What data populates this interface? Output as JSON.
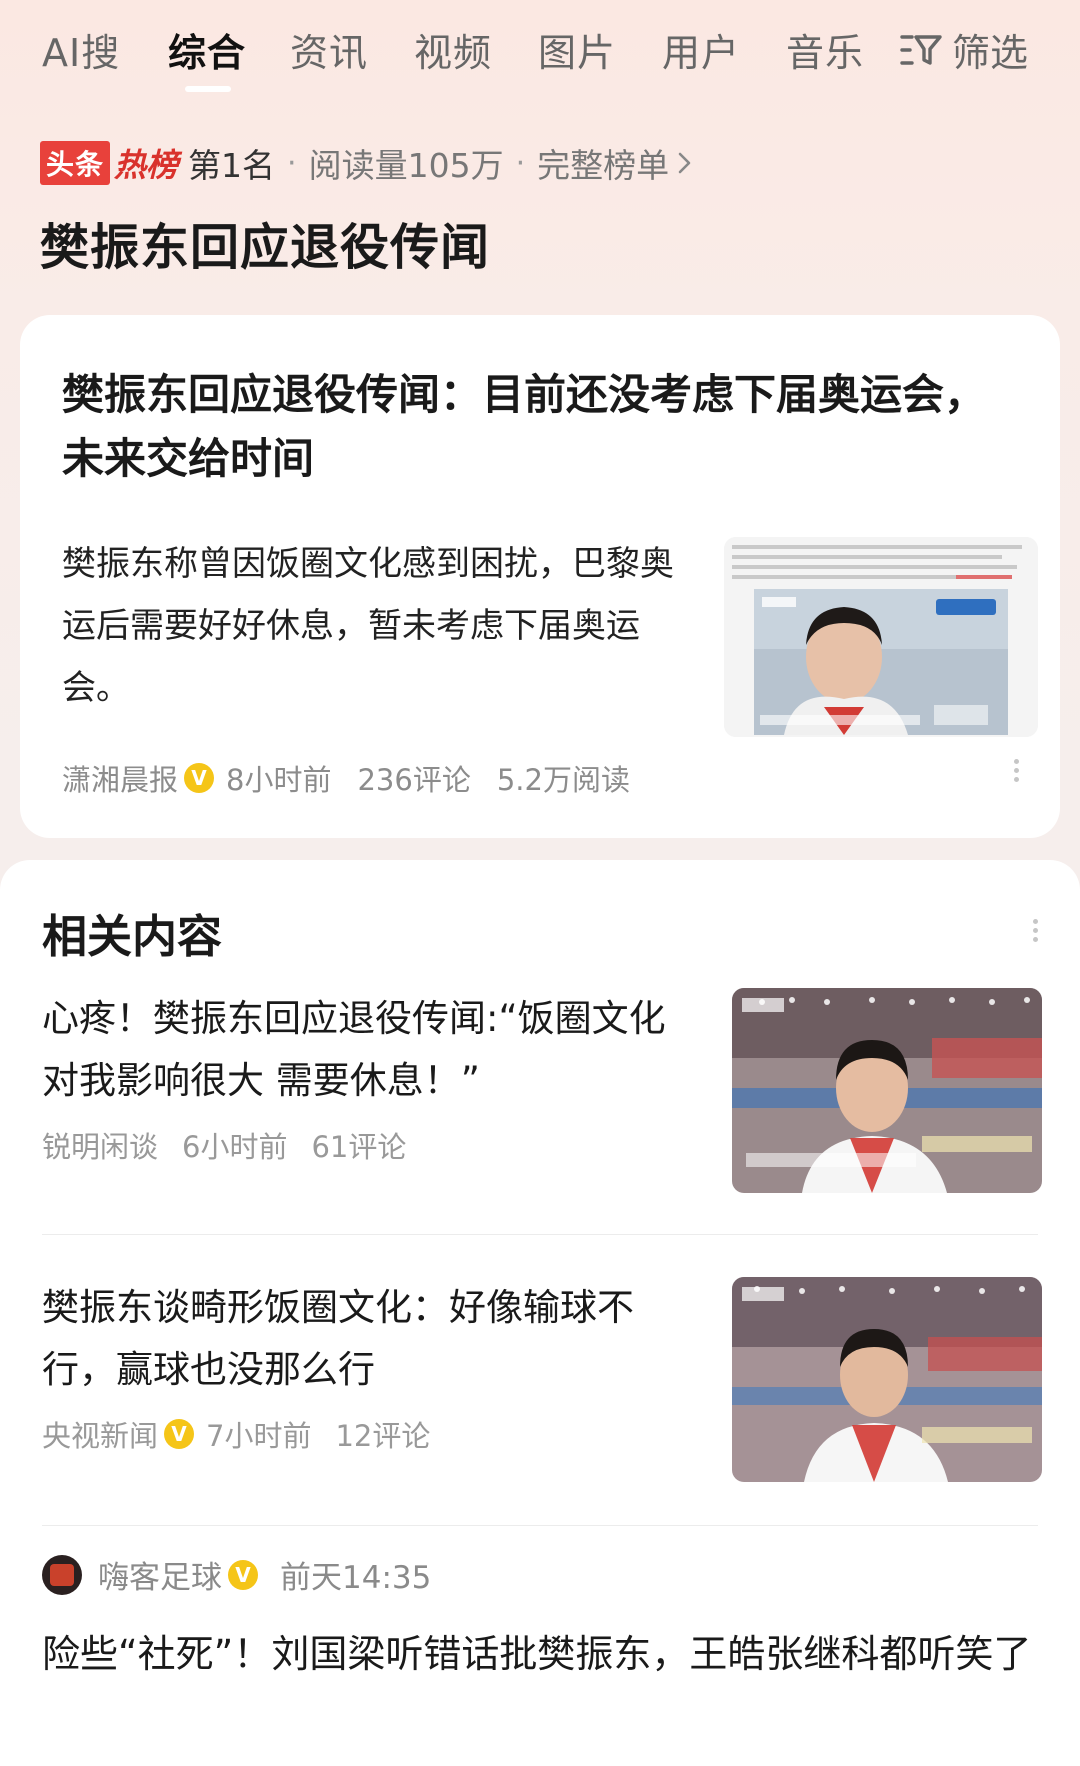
{
  "tabs": {
    "items": [
      {
        "label": "AI搜"
      },
      {
        "label": "综合"
      },
      {
        "label": "资讯"
      },
      {
        "label": "视频"
      },
      {
        "label": "图片"
      },
      {
        "label": "用户"
      },
      {
        "label": "音乐"
      }
    ],
    "filter_label": "筛选",
    "active": "综合"
  },
  "hot": {
    "badge": "头条",
    "word": "热榜",
    "rank": "第1名",
    "reads": "阅读量105万",
    "full_list": "完整榜单",
    "sep": "·"
  },
  "topic_title": "樊振东回应退役传闻",
  "card1": {
    "title": "樊振东回应退役传闻：目前还没考虑下届奥运会，未来交给时间",
    "abstract": "樊振东称曾因饭圈文化感到困扰，巴黎奥运后需要好好休息，暂未考虑下届奥运会。",
    "source": "潇湘晨报",
    "time": "8小时前",
    "comments": "236评论",
    "reads": "5.2万阅读",
    "verified_mark": "V"
  },
  "related": {
    "title": "相关内容",
    "items": [
      {
        "title": "心疼！樊振东回应退役传闻:“饭圈文化对我影响很大 需要休息！”",
        "source": "锐明闲谈",
        "time": "6小时前",
        "comments": "61评论"
      },
      {
        "title": "樊振东谈畸形饭圈文化：好像输球不行，赢球也没那么行",
        "source": "央视新闻",
        "time": "7小时前",
        "comments": "12评论",
        "verified_mark": "V"
      }
    ],
    "post": {
      "author": "嗨客足球",
      "time": "前天14:35",
      "verified_mark": "V",
      "title": "险些“社死”！刘国梁听错话批樊振东，王皓张继科都听笑了"
    }
  },
  "colors": {
    "accent_red": "#e8413b",
    "verified_gold": "#f5c518"
  }
}
